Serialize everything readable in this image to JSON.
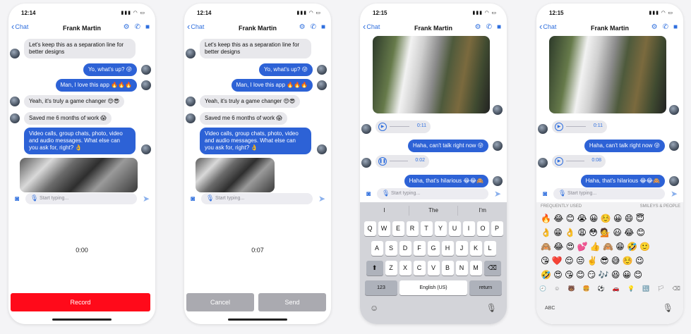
{
  "status": {
    "time_a": "12:14",
    "time_b": "12:15",
    "icons": "▮▮▮ ◠ ▭"
  },
  "nav": {
    "back_label": "Chat",
    "title": "Frank Martin"
  },
  "messages": {
    "m1": "Let's keep this as a separation line for better designs",
    "m2": "Yo, what's up? 😜",
    "m3": "Man, I love this app 🔥🔥🔥",
    "m4": "Yeah, it's truly a game changer 😍😎",
    "m5": "Saved me 6 months of work 😱",
    "m6": "Video calls, group chats, photo, video and audio messages. What else can you ask for, right? 👌",
    "m7": "Haha, can't talk right now 😜",
    "m8": "Haha, that's hilarious 😂😂🙈"
  },
  "audio": {
    "a1": "0:11",
    "a2": "0:02",
    "a3": "0:08"
  },
  "input": {
    "placeholder": "Start typing..."
  },
  "recording": {
    "timer1": "0:00",
    "timer2": "0:07",
    "record_label": "Record",
    "cancel_label": "Cancel",
    "send_label": "Send"
  },
  "keyboard": {
    "suggestions": [
      "I",
      "The",
      "I'm"
    ],
    "row1": [
      "Q",
      "W",
      "E",
      "R",
      "T",
      "Y",
      "U",
      "I",
      "O",
      "P"
    ],
    "row2": [
      "A",
      "S",
      "D",
      "F",
      "G",
      "H",
      "J",
      "K",
      "L"
    ],
    "row3": [
      "Z",
      "X",
      "C",
      "V",
      "B",
      "N",
      "M"
    ],
    "num_label": "123",
    "space_label": "English (US)",
    "return_label": "return"
  },
  "emoji": {
    "frequently_used": "FREQUENTLY USED",
    "smileys": "SMILEYS & PEOPLE",
    "abc_label": "ABC",
    "rows": [
      "🔥 😂 😊 😭 😀 ☺️ 😀 😄 😇",
      "👌 😁 👌 😩 😳 💁 😃 😂 😊",
      "🙈 😂 😍 💕 👍 🙈 😁 🤣 🙂",
      "😘 ❤️ 😌 😒 ✌️ 😎 😅 ☺️ 😉",
      "🤣 😍 😘 😊 😏 🎶 😆 😀 😊"
    ],
    "categories": [
      "🕘",
      "☺",
      "🐻",
      "🍔",
      "⚽",
      "🚗",
      "💡",
      "🔣",
      "🏳",
      "⌫"
    ]
  },
  "colors": {
    "accent": "#2d62d6",
    "record": "#ff0a1a",
    "bubble_in": "#e8e8ec"
  }
}
